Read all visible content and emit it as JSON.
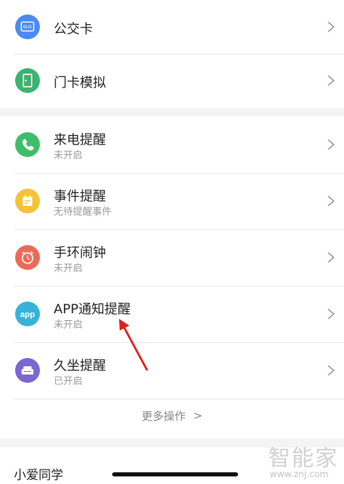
{
  "section_top": {
    "items": [
      {
        "title": "公交卡",
        "icon": "bus-card-icon",
        "icon_text": "BUS",
        "color": "#4a8af4"
      },
      {
        "title": "门卡模拟",
        "icon": "door-card-icon",
        "color": "#3cb371"
      }
    ]
  },
  "section_reminders": {
    "items": [
      {
        "title": "来电提醒",
        "subtitle": "未开启",
        "icon": "phone-icon",
        "color": "#3fbe6a"
      },
      {
        "title": "事件提醒",
        "subtitle": "无待提醒事件",
        "icon": "calendar-icon",
        "color": "#f5c23a"
      },
      {
        "title": "手环闹钟",
        "subtitle": "未开启",
        "icon": "alarm-clock-icon",
        "color": "#ef6a55"
      },
      {
        "title": "APP通知提醒",
        "subtitle": "未开启",
        "icon": "app-icon",
        "icon_text": "app",
        "color": "#35b3d8"
      },
      {
        "title": "久坐提醒",
        "subtitle": "已开启",
        "icon": "sofa-icon",
        "color": "#7a67cf"
      }
    ],
    "more_label": "更多操作",
    "more_chevron": ">"
  },
  "section_bottom": {
    "title": "小爱同学"
  },
  "watermark": {
    "text": "智能家",
    "url": "www.znj.com"
  },
  "annotation_color": "#e0201b",
  "chevron": ">"
}
